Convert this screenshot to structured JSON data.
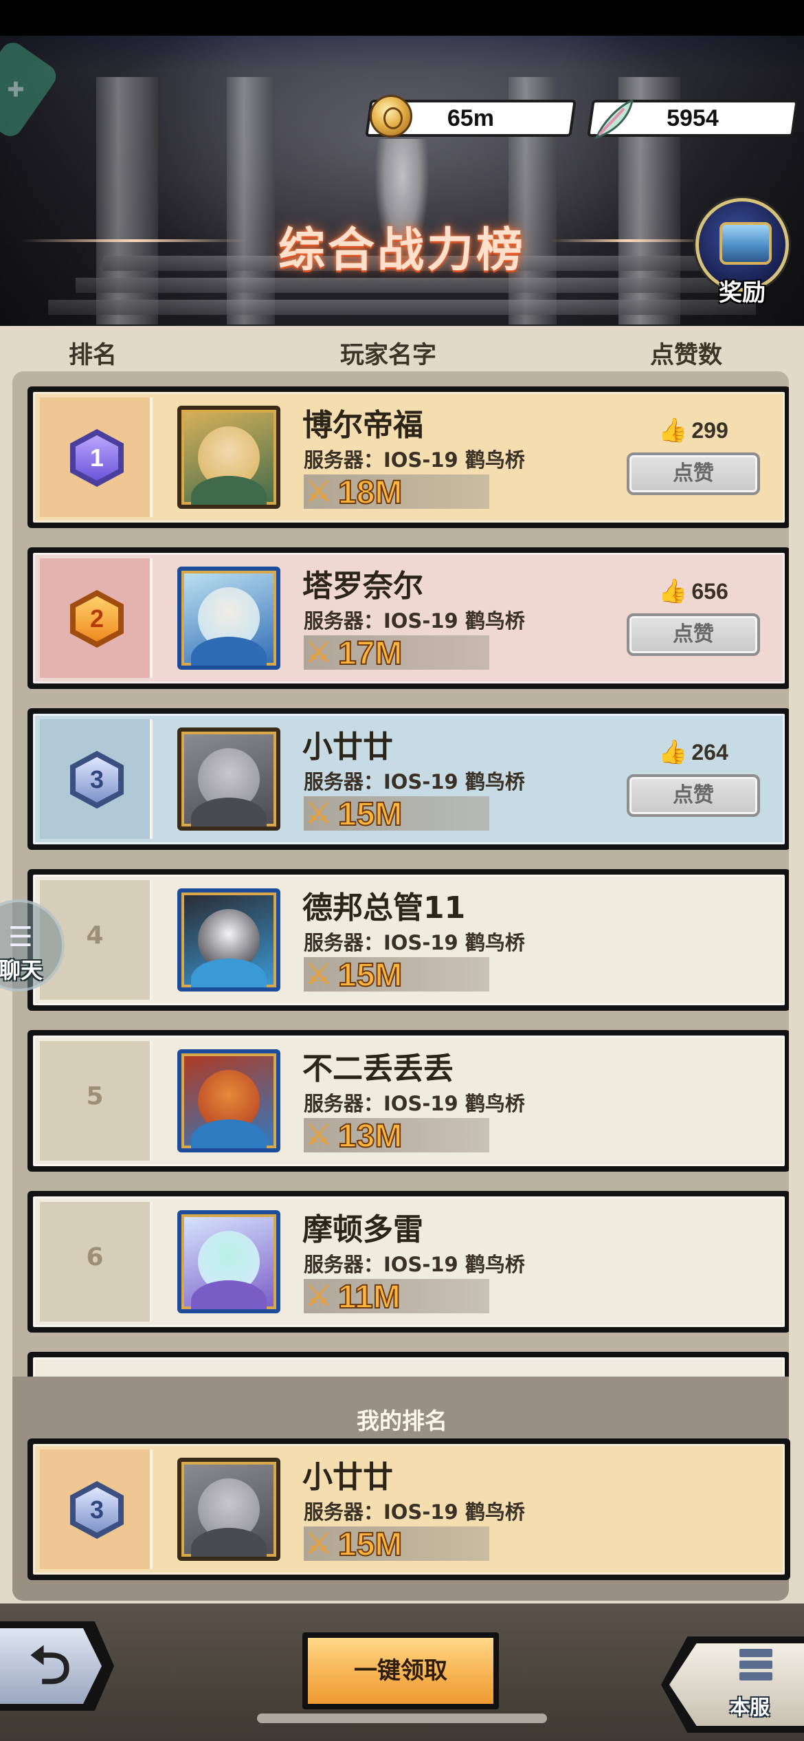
{
  "header": {
    "coins": "65m",
    "feathers": "5954",
    "title": "综合战力榜",
    "reward_label": "奖励"
  },
  "columns": {
    "rank": "排名",
    "player_name": "玩家名字",
    "likes": "点赞数"
  },
  "rows": [
    {
      "rank": "1",
      "name": "博尔帝福",
      "server": "服务器：IOS-19 鹳鸟桥",
      "power": "18M",
      "likes": "299",
      "like_label": "点赞",
      "bg": "#f4deb0",
      "rank_bg": "#efc793",
      "border": "#f5edd8"
    },
    {
      "rank": "2",
      "name": "塔罗奈尔",
      "server": "服务器：IOS-19 鹳鸟桥",
      "power": "17M",
      "likes": "656",
      "like_label": "点赞",
      "bg": "#f0d8d2",
      "rank_bg": "#e3b3b0",
      "border": "#f5ecec"
    },
    {
      "rank": "3",
      "name": "小廿廿",
      "server": "服务器：IOS-19 鹳鸟桥",
      "power": "15M",
      "likes": "264",
      "like_label": "点赞",
      "bg": "#c7dbe4",
      "rank_bg": "#b1c9d6",
      "border": "#eaf2f6"
    },
    {
      "rank": "4",
      "name": "德邦总管11",
      "server": "服务器：IOS-19 鹳鸟桥",
      "power": "15M",
      "bg": "#efebdf",
      "rank_bg": "#d6ceb8",
      "border": "#f9f6ef"
    },
    {
      "rank": "5",
      "name": "不二丢丢丢",
      "server": "服务器：IOS-19 鹳鸟桥",
      "power": "13M",
      "bg": "#efebdf",
      "rank_bg": "#d6ceb8",
      "border": "#f9f6ef"
    },
    {
      "rank": "6",
      "name": "摩顿多雷",
      "server": "服务器：IOS-19 鹳鸟桥",
      "power": "11M",
      "bg": "#efebdf",
      "rank_bg": "#d6ceb8",
      "border": "#f9f6ef"
    }
  ],
  "my_rank": {
    "title": "我的排名",
    "rank": "3",
    "name": "小廿廿",
    "server": "服务器：IOS-19 鹳鸟桥",
    "power": "15M",
    "bg": "#f4deb0",
    "rank_bg": "#efc793"
  },
  "chat_label": "聊天",
  "footer": {
    "claim_all": "一键领取",
    "server_label": "本服"
  },
  "icons": [
    "controller-icon",
    "coin-icon",
    "feather-icon",
    "chest-icon",
    "thumbs-up-icon",
    "swords-icon",
    "chat-icon",
    "back-arrow-icon",
    "server-list-icon"
  ]
}
